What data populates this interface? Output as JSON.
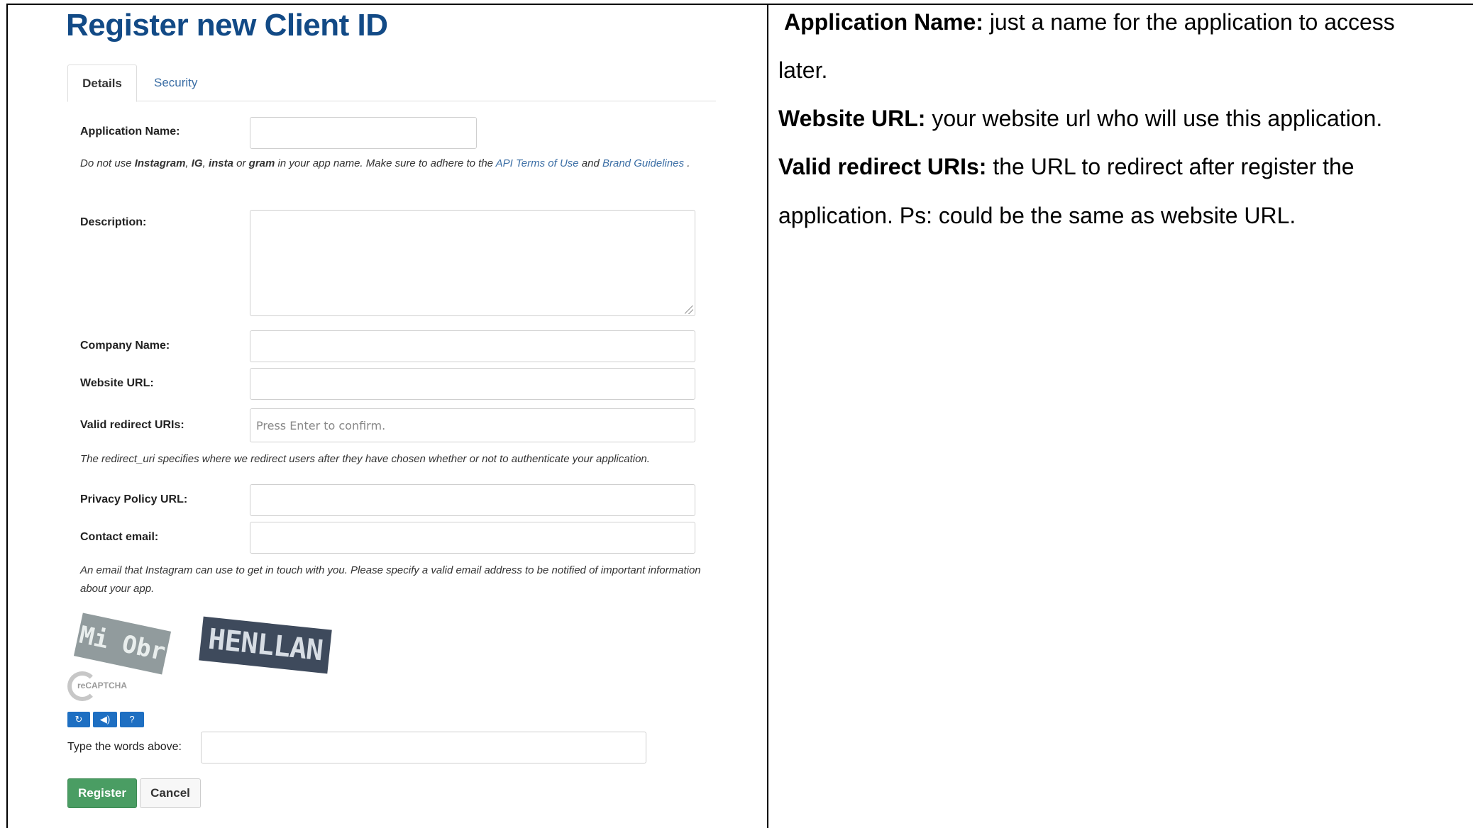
{
  "page_title": "Register new Client ID",
  "tabs": [
    {
      "label": "Details",
      "active": true
    },
    {
      "label": "Security",
      "active": false
    }
  ],
  "form": {
    "application_name_label": "Application Name:",
    "name_hint": {
      "pre": "Do not use ",
      "w1": "Instagram",
      "sep1": ", ",
      "w2": "IG",
      "sep2": ", ",
      "w3": "insta",
      "sep3": " or ",
      "w4": "gram",
      "mid": " in your app name. Make sure to adhere to the ",
      "link1": "API Terms of Use",
      "and": " and ",
      "link2": "Brand Guidelines",
      "end": " ."
    },
    "description_label": "Description:",
    "company_name_label": "Company Name:",
    "website_url_label": "Website URL:",
    "redirect_label": "Valid redirect URIs:",
    "redirect_placeholder": "Press Enter to confirm.",
    "redirect_hint": "The redirect_uri specifies where we redirect users after they have chosen whether or not to authenticate your application.",
    "privacy_label": "Privacy Policy URL:",
    "contact_label": "Contact email:",
    "email_hint": "An email that Instagram can use to get in touch with you. Please specify a valid email address to be notified of important information about your app."
  },
  "captcha": {
    "word1": "Mi Obr",
    "word2": "HENLLAN",
    "logo_text": "reCAPTCHA",
    "words_label": "Type the words above:"
  },
  "buttons": {
    "register": "Register",
    "cancel": "Cancel"
  },
  "explanations": [
    {
      "term": "Application Name:",
      "text": " just a name for the application to access"
    },
    {
      "term": "",
      "text": "later."
    },
    {
      "term": "Website URL:",
      "text": " your website url who will use this application."
    },
    {
      "term": "Valid redirect URIs:",
      "text": " the URL to redirect after register the"
    },
    {
      "term": "",
      "text": "application. Ps: could be the same as website URL."
    }
  ]
}
